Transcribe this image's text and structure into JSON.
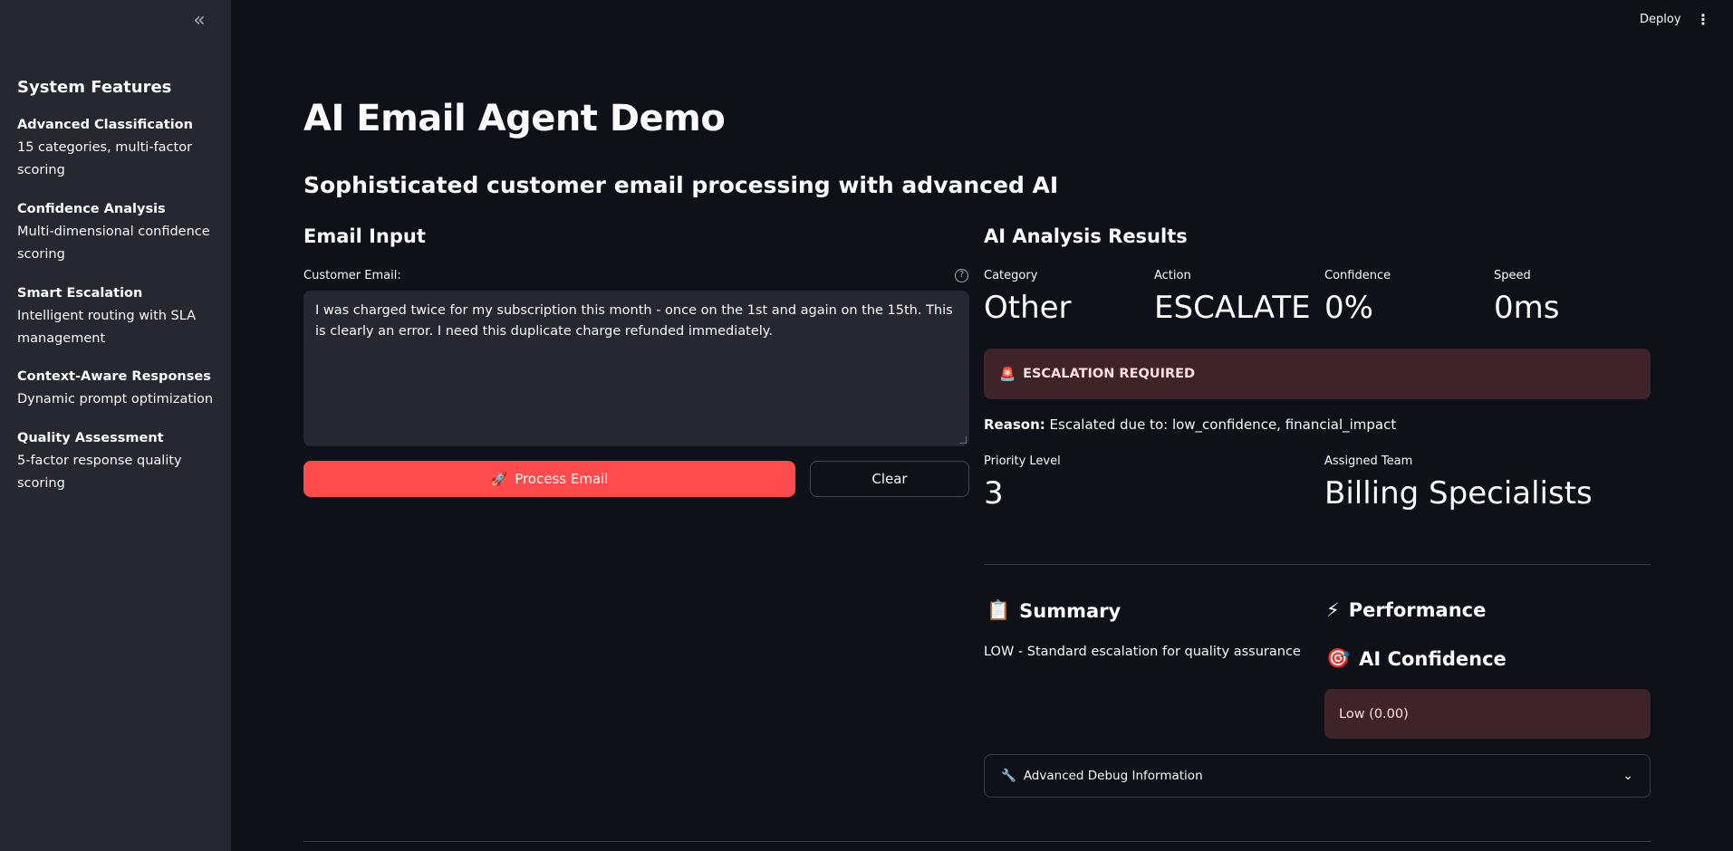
{
  "sidebar": {
    "collapse_icon": "«",
    "title": "System Features",
    "features": [
      {
        "name": "Advanced Classification",
        "desc": "15 categories, multi-factor scoring"
      },
      {
        "name": "Confidence Analysis",
        "desc": "Multi-dimensional confidence scoring"
      },
      {
        "name": "Smart Escalation",
        "desc": "Intelligent routing with SLA management"
      },
      {
        "name": "Context-Aware Responses",
        "desc": "Dynamic prompt optimization"
      },
      {
        "name": "Quality Assessment",
        "desc": "5-factor response quality scoring"
      }
    ]
  },
  "header": {
    "deploy_label": "Deploy",
    "menu_icon": "⋮"
  },
  "main": {
    "title": "AI Email Agent Demo",
    "subtitle": "Sophisticated customer email processing with advanced AI",
    "input": {
      "heading": "Email Input",
      "label": "Customer Email:",
      "help_icon": "?",
      "value": "I was charged twice for my subscription this month - once on the 1st and again on the 15th. This is clearly an error. I need this duplicate charge refunded immediately.",
      "process_icon": "🚀",
      "process_label": "Process Email",
      "clear_label": "Clear"
    },
    "results": {
      "heading": "AI Analysis Results",
      "metrics": [
        {
          "label": "Category",
          "value": "Other"
        },
        {
          "label": "Action",
          "value": "ESCALATE"
        },
        {
          "label": "Confidence",
          "value": "0%"
        },
        {
          "label": "Speed",
          "value": "0ms"
        }
      ],
      "escalation_icon": "🚨",
      "escalation_text": "ESCALATION REQUIRED",
      "reason_label": "Reason:",
      "reason_text": "Escalated due to: low_confidence, financial_impact",
      "priority_label": "Priority Level",
      "priority_value": "3",
      "team_label": "Assigned Team",
      "team_value": "Billing Specialists",
      "summary_icon": "📋",
      "summary_heading": "Summary",
      "summary_text": "LOW - Standard escalation for quality assurance",
      "performance_icon": "⚡",
      "performance_heading": "Performance",
      "confidence_icon": "🎯",
      "confidence_heading": "AI Confidence",
      "confidence_text": "Low (0.00)",
      "debug_icon": "🔧",
      "debug_label": "Advanced Debug Information",
      "debug_chevron": "⌄"
    }
  }
}
